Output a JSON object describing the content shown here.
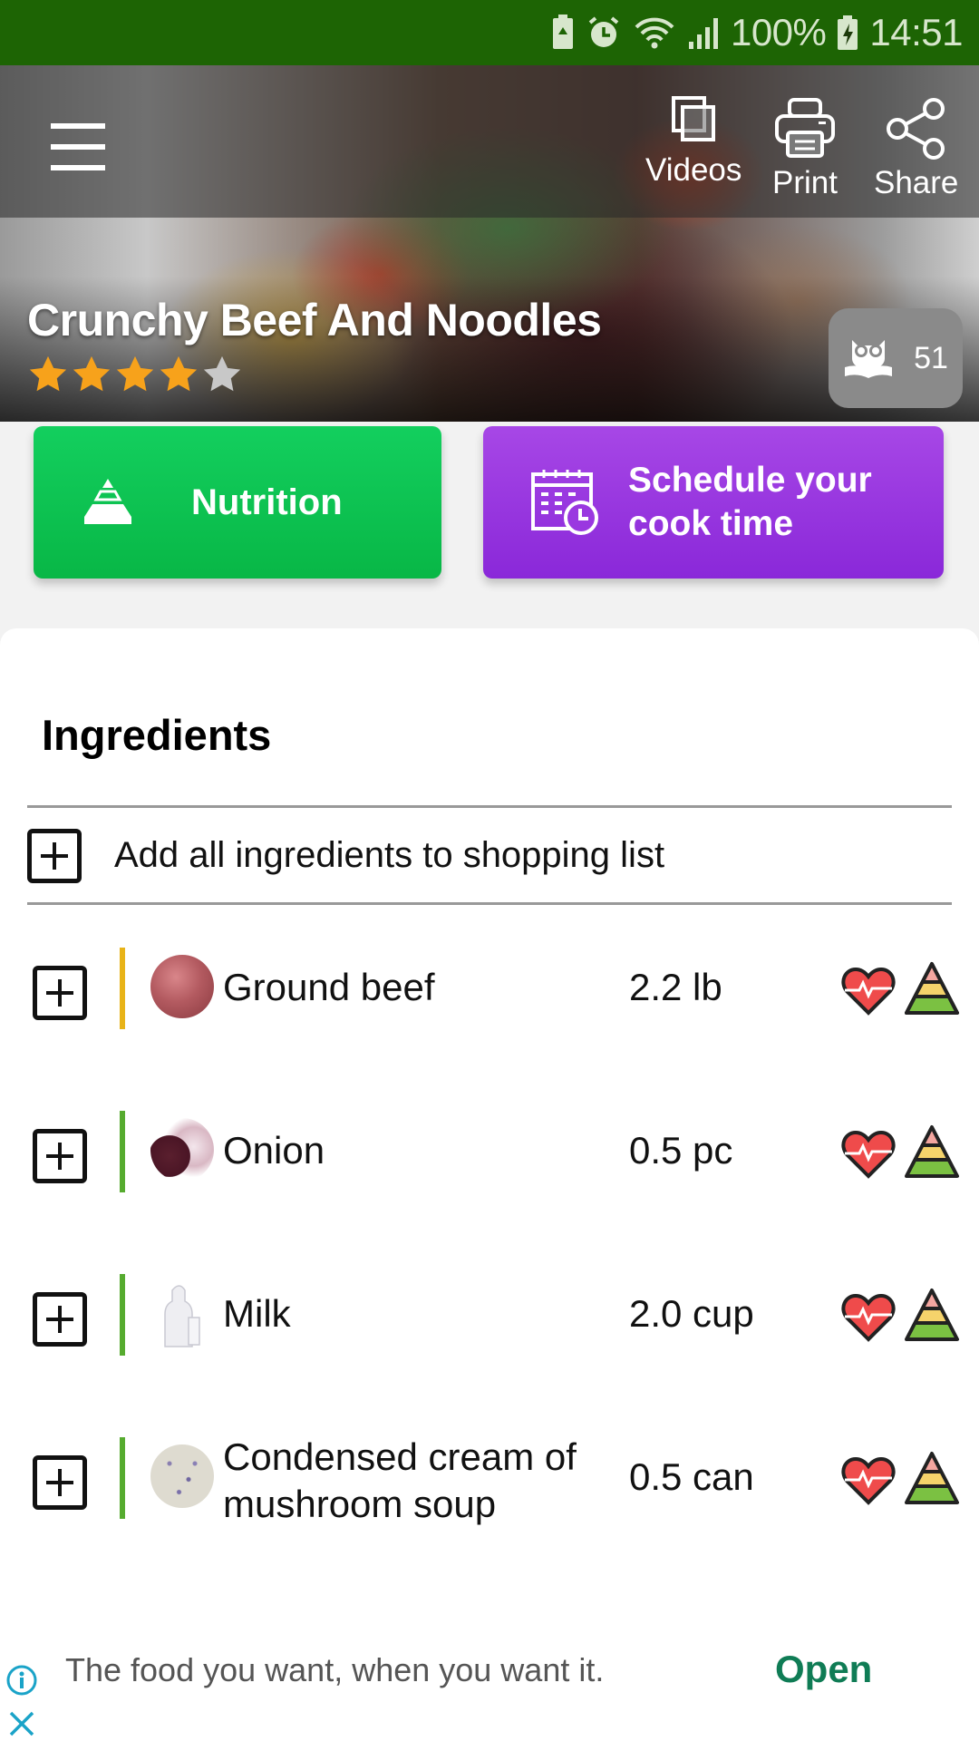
{
  "status_bar": {
    "battery_percent": "100%",
    "time": "14:51",
    "icons": [
      "battery-saver-icon",
      "alarm-icon",
      "wifi-icon",
      "signal-icon",
      "battery-charging-icon"
    ]
  },
  "header": {
    "menu_icon": "hamburger-menu-icon",
    "actions": [
      {
        "label": "Videos",
        "icon": "videos-icon"
      },
      {
        "label": "Print",
        "icon": "printer-icon"
      },
      {
        "label": "Share",
        "icon": "share-icon"
      }
    ]
  },
  "recipe": {
    "title": "Crunchy Beef And Noodles",
    "rating": 4,
    "rating_max": 5,
    "cookbook_count": "51",
    "colors": {
      "star_filled": "#f7a21b",
      "star_empty": "#c8c8c8"
    }
  },
  "buttons": {
    "nutrition": {
      "label": "Nutrition",
      "color": "#0fc453"
    },
    "schedule": {
      "label": "Schedule your cook time",
      "color": "#9a38e0"
    }
  },
  "ingredients": {
    "title": "Ingredients",
    "add_all_label": "Add all ingredients to shopping list",
    "items": [
      {
        "name": "Ground beef",
        "quantity": "2.2 lb",
        "bar_color": "#e8b318",
        "thumb": "ground-beef"
      },
      {
        "name": "Onion",
        "quantity": "0.5 pc",
        "bar_color": "#56ab2f",
        "thumb": "onion"
      },
      {
        "name": "Milk",
        "quantity": "2.0 cup",
        "bar_color": "#56ab2f",
        "thumb": "milk"
      },
      {
        "name": "Condensed cream of mushroom soup",
        "quantity": "0.5 can",
        "bar_color": "#56ab2f",
        "thumb": "mushroom-soup"
      }
    ]
  },
  "ad": {
    "text": "The food you want, when you want it.",
    "cta": "Open",
    "cta_color": "#0f7c55"
  }
}
